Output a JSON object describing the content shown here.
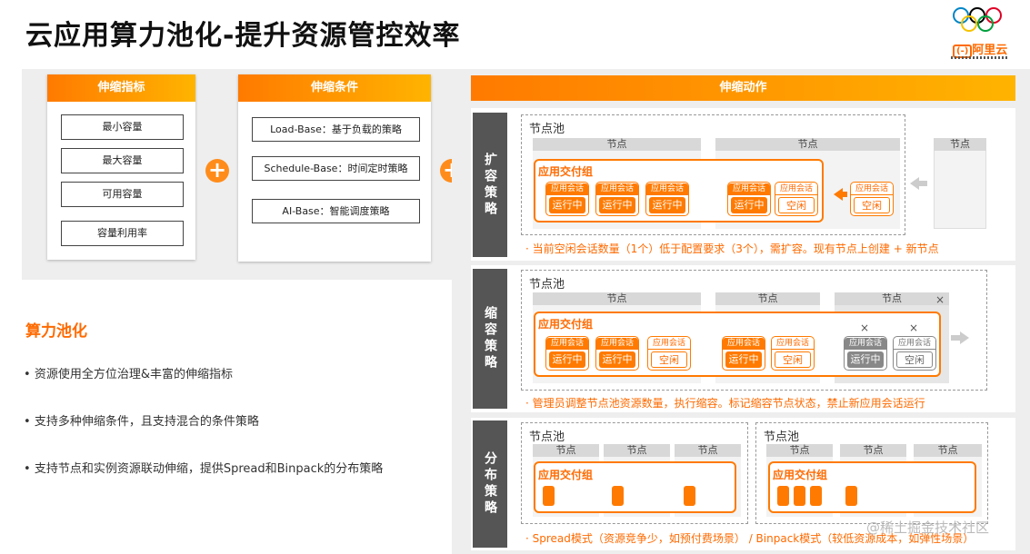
{
  "title": "云应用算力池化-提升资源管控效率",
  "logo": {
    "brand": "阿里云"
  },
  "metrics": {
    "head": "伸缩指标",
    "items": [
      "最小容量",
      "最大容量",
      "可用容量",
      "容量利用率"
    ]
  },
  "conditions": {
    "head": "伸缩条件",
    "items": [
      "Load-Base：基于负载的策略",
      "Schedule-Base：时间定时策略",
      "AI-Base：智能调度策略"
    ]
  },
  "plus_symbol": "+",
  "pooling": {
    "title": "算力池化",
    "bullets": [
      "资源使用全方位治理&丰富的伸缩指标",
      "支持多种伸缩条件，且支持混合的条件策略",
      "支持节点和实例资源联动伸缩，提供Spread和Binpack的分布策略"
    ],
    "bullet_dot": "•"
  },
  "actions": {
    "head": "伸缩动作",
    "pool_label": "节点池",
    "node_label": "节点",
    "group_label": "应用交付组",
    "session_label": "应用会话",
    "running": "运行中",
    "idle": "空闲",
    "cross": "×",
    "expand": {
      "label": "扩容策略",
      "note": "· 当前空闲会话数量（1个）低于配置要求（3个），需扩容。现有节点上创建 + 新节点"
    },
    "shrink": {
      "label": "缩容策略",
      "note": "· 管理员调整节点池资源数量，执行缩容。标记缩容节点状态，禁止新应用会话运行"
    },
    "distribute": {
      "label": "分布策略",
      "note": "· Spread模式（资源竞争少，如预付费场景） / Binpack模式（较低资源成本，如弹性场景）"
    }
  },
  "watermark": "@稀土掘金技术社区",
  "colors": {
    "accent": "#ff7a00",
    "gray": "#555555"
  }
}
